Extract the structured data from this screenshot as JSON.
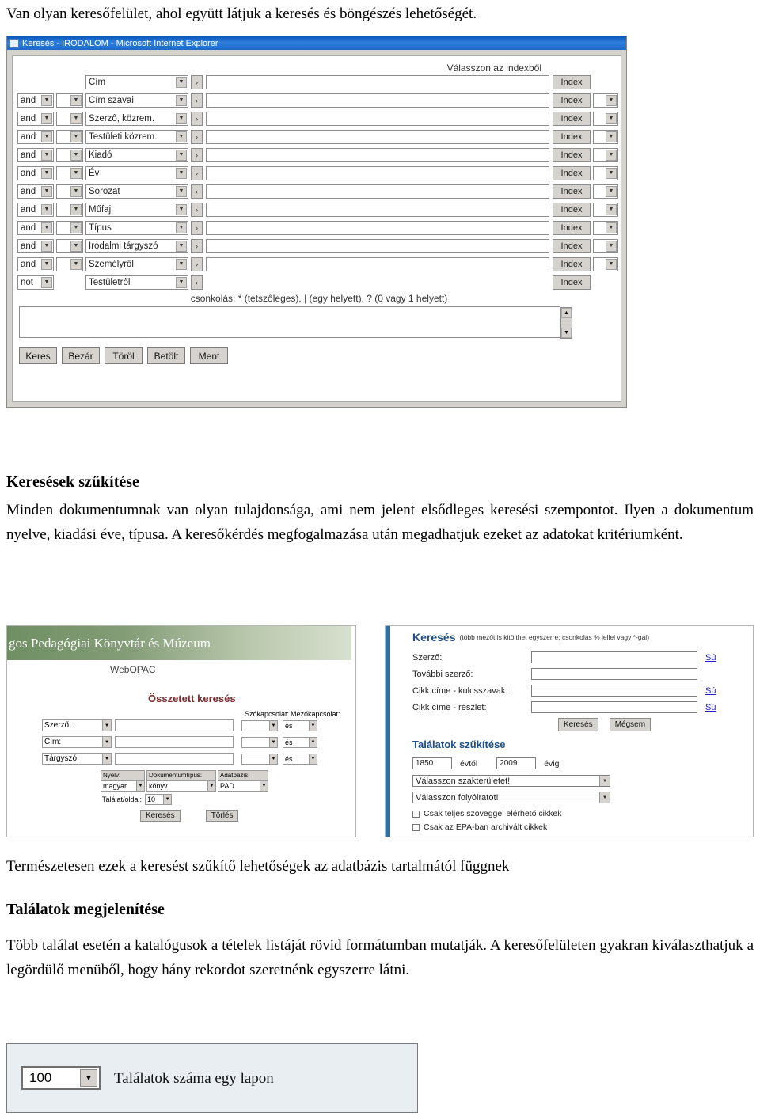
{
  "document": {
    "top_sentence": "Van olyan keresőfelület, ahol együtt látjuk a keresés és böngészés lehetőségét.",
    "section1_title": "Keresések szűkítése",
    "section1_paragraph": "Minden dokumentumnak van olyan tulajdonsága, ami nem jelent elsődleges keresési szempontot. Ilyen a dokumentum nyelve, kiadási éve, típusa. A keresőkérdés megfogalmazása után megadhatjuk ezeket az adatokat kritériumként.",
    "paragraph_termeszetesen": "Természetesen ezek a keresést szűkítő lehetőségek az adatbázis tartalmától függnek",
    "section2_title": "Találatok megjelenítése",
    "paragraph_tobb": "Több találat esetén a katalógusok a tételek listáját rövid formátumban mutatják. A keresőfelületen gyakran kiválaszthatjuk a legördülő menüből, hogy hány rekordot szeretnénk egyszerre látni."
  },
  "ie_window": {
    "title": "Keresés - IRODALOM - Microsoft Internet Explorer",
    "index_header": "Válasszon az indexből",
    "index_button_label": "Index",
    "truncation_hint": "csonkolás: * (tetszőleges), | (egy helyett), ? (0 vagy 1 helyett)",
    "rows": [
      {
        "bool": "",
        "field": "Cím"
      },
      {
        "bool": "and",
        "field": "Cím szavai"
      },
      {
        "bool": "and",
        "field": "Szerző, közrem."
      },
      {
        "bool": "and",
        "field": "Testületi közrem."
      },
      {
        "bool": "and",
        "field": "Kiadó"
      },
      {
        "bool": "and",
        "field": "Év"
      },
      {
        "bool": "and",
        "field": "Sorozat"
      },
      {
        "bool": "and",
        "field": "Műfaj"
      },
      {
        "bool": "and",
        "field": "Típus"
      },
      {
        "bool": "and",
        "field": "Irodalmi tárgyszó"
      },
      {
        "bool": "and",
        "field": "Személyről"
      },
      {
        "bool": "not",
        "field": "Testületről"
      }
    ],
    "buttons": [
      "Keres",
      "Bezár",
      "Töröl",
      "Betölt",
      "Ment"
    ]
  },
  "opac_left": {
    "header": "gos Pedagógiai Könyvtár és Múzeum",
    "webopac": "WebOPAC",
    "subtitle": "Összetett keresés",
    "col_head_1": "Szókapcsolat:",
    "col_head_2": "Mezőkapcsolat:",
    "fields": [
      {
        "label": "Szerző:",
        "join": "és"
      },
      {
        "label": "Cím:",
        "join": "és"
      },
      {
        "label": "Tárgyszó:",
        "join": "és"
      }
    ],
    "limit_labels": [
      "Nyelv:",
      "Dokumentumtípus:",
      "Adatbázis:"
    ],
    "limit_values": [
      "magyar",
      "könyv",
      "PAD"
    ],
    "per_page_label": "Találat/oldal:",
    "per_page_value": "10",
    "buttons": [
      "Keresés",
      "Törlés"
    ]
  },
  "opac_right": {
    "header_title": "Keresés",
    "header_note": "(több mezőt is kitölthet egyszerre; csonkolás % jellel vagy *-gal)",
    "fields": [
      {
        "label": "Szerző:",
        "link": "Sú"
      },
      {
        "label": "További szerző:",
        "link": ""
      },
      {
        "label": "Cikk címe - kulcsszavak:",
        "link": "Sú"
      },
      {
        "label": "Cikk címe - részlet:",
        "link": "Sú"
      }
    ],
    "buttons": [
      "Keresés",
      "Mégsem"
    ],
    "narrow_title": "Találatok szűkítése",
    "year_from": "1850",
    "year_from_label": "évtől",
    "year_to": "2009",
    "year_to_label": "évig",
    "select_subject": "Válasszon szakterületet!",
    "select_journal": "Válasszon folyóiratot!",
    "checkbox_fulltext": "Csak teljes szöveggel elérhető cikkek",
    "checkbox_epa": "Csak az EPA-ban archivált cikkek",
    "epa_link": "EPA"
  },
  "results_figure": {
    "value": "100",
    "caption": "Találatok száma egy lapon"
  },
  "icons": {
    "chevron_down": "▼",
    "chevron_right": "›",
    "scroll_up": "▲",
    "scroll_down": "▼"
  }
}
